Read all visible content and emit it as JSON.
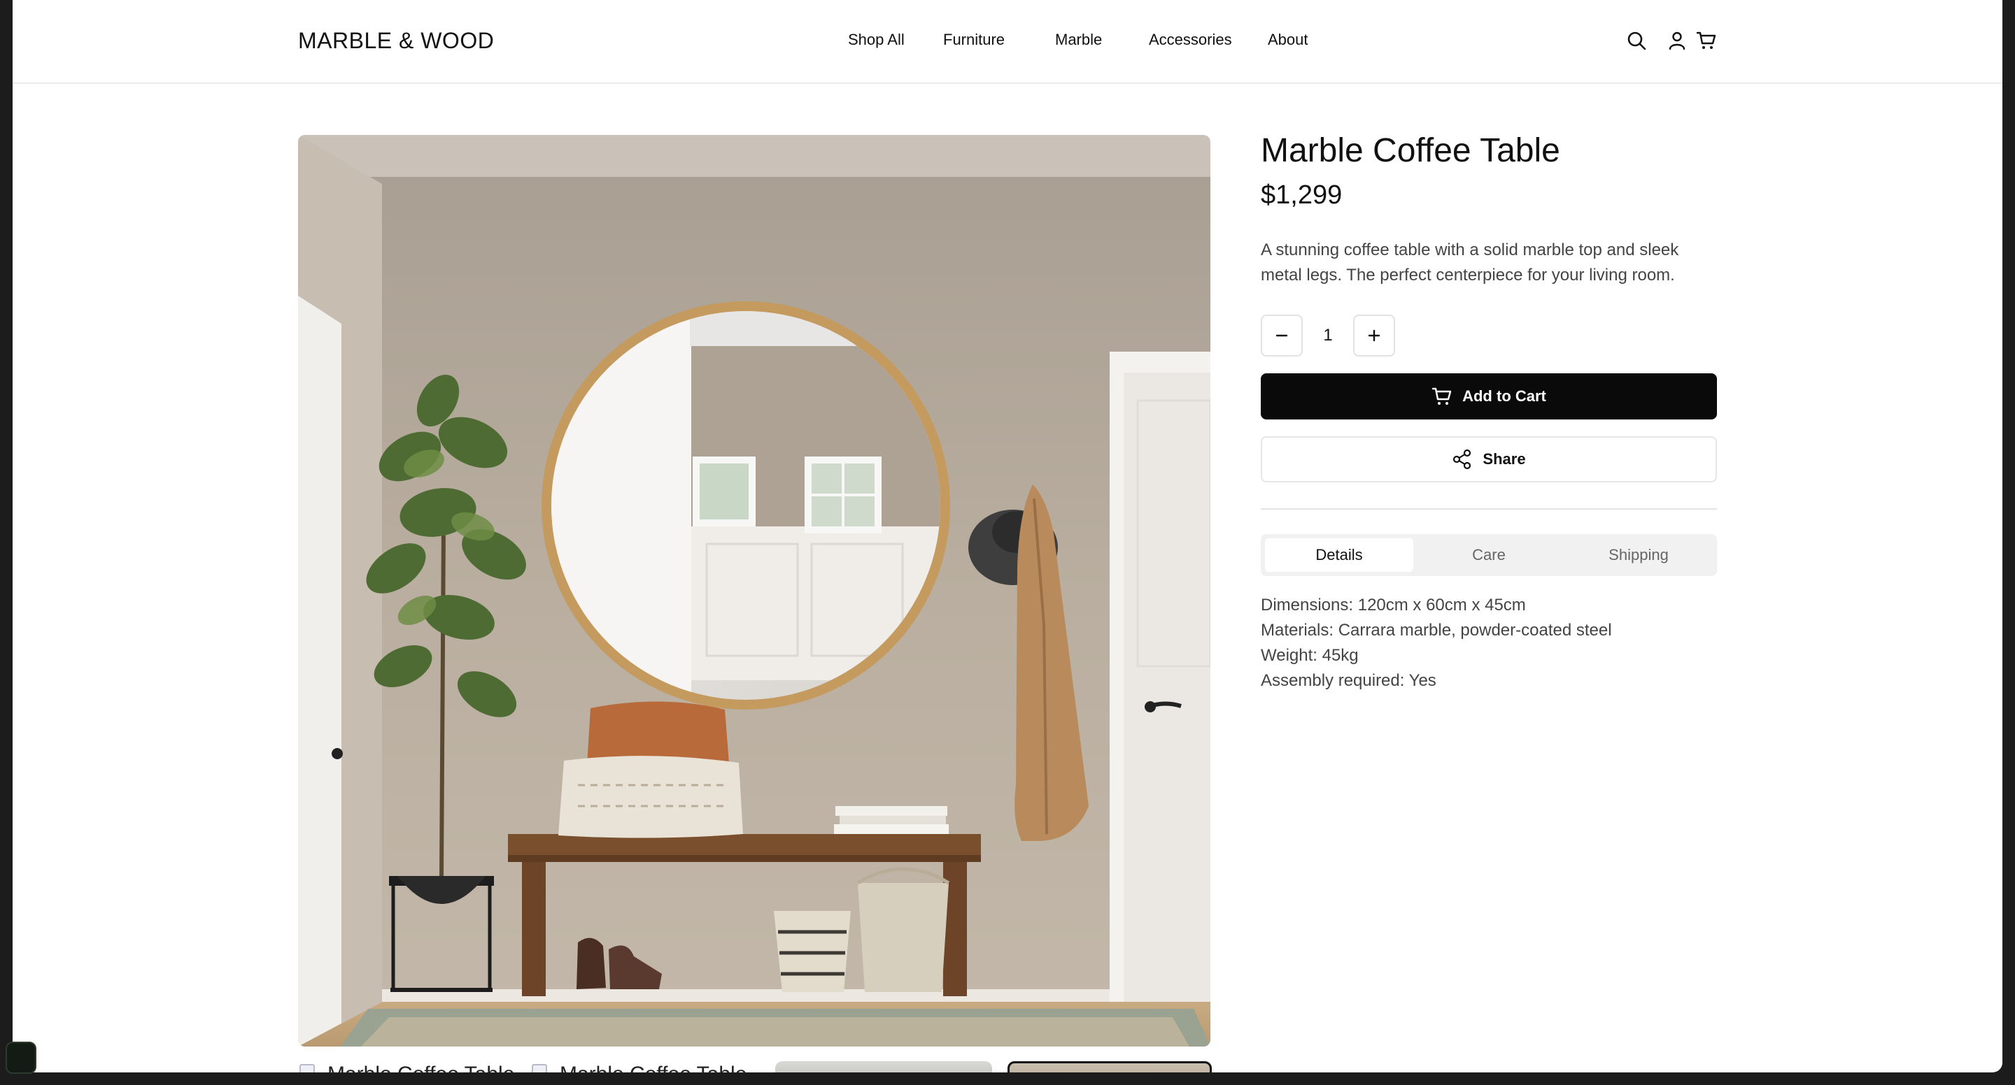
{
  "header": {
    "brand": "MARBLE & WOOD",
    "nav": [
      "Shop All",
      "Furniture",
      "Marble",
      "Accessories",
      "About"
    ],
    "icons": [
      "search-icon",
      "account-icon",
      "cart-icon"
    ]
  },
  "product": {
    "title": "Marble Coffee Table",
    "price": "$1,299",
    "description": "A stunning coffee table with a solid marble top and sleek metal legs. The perfect centerpiece for your living room.",
    "quantity": "1",
    "add_to_cart_label": "Add to Cart",
    "share_label": "Share",
    "tabs": [
      "Details",
      "Care",
      "Shipping"
    ],
    "active_tab": "Details",
    "details": [
      "Dimensions: 120cm x 60cm x 45cm",
      "Materials: Carrara marble, powder-coated steel",
      "Weight: 45kg",
      "Assembly required: Yes"
    ]
  },
  "gallery": {
    "thumbnails": [
      {
        "alt": "Marble Coffee Table"
      },
      {
        "alt": "Marble Coffee Table"
      },
      {
        "alt": ""
      },
      {
        "alt": ""
      }
    ]
  },
  "colors": {
    "button_primary": "#0a0a0a",
    "tab_bg": "#f1f1f1",
    "wall": "#b5aa9c",
    "wood": "#7a4f2e"
  }
}
